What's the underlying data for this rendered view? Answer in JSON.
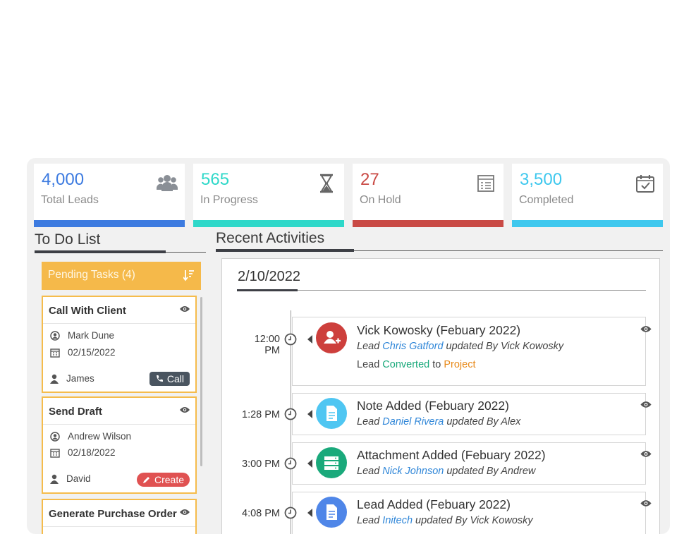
{
  "stats": [
    {
      "value": "4,000",
      "label": "Total Leads",
      "color": "#3d7be0",
      "icon": "users-icon"
    },
    {
      "value": "565",
      "label": "In Progress",
      "color": "#2ed8c9",
      "icon": "hourglass-icon"
    },
    {
      "value": "27",
      "label": "On Hold",
      "color": "#c94a45",
      "icon": "checklist-icon"
    },
    {
      "value": "3,500",
      "label": "Completed",
      "color": "#3fc8ee",
      "icon": "calendar-check-icon"
    }
  ],
  "todo": {
    "title": "To Do List",
    "pending_label": "Pending Tasks (4)",
    "tasks": [
      {
        "title": "Call With Client",
        "contact": "Mark Dune",
        "date": "02/15/2022",
        "assignee": "James",
        "action": "Call",
        "action_color": "#4a5560"
      },
      {
        "title": "Send Draft",
        "contact": "Andrew Wilson",
        "date": "02/18/2022",
        "assignee": "David",
        "action": "Create",
        "action_color": "#e05252"
      },
      {
        "title": "Generate Purchase Order"
      }
    ]
  },
  "recent": {
    "title": "Recent Activities",
    "date": "2/10/2022",
    "items": [
      {
        "time": "12:00 PM",
        "title": "Vick Kowosky  (Febuary 2022)",
        "icon": "add-user-icon",
        "color": "#cd3f3c",
        "line_prefix": "Lead ",
        "line_link": "Chris Gatford",
        "line_suffix": " updated By Vick Kowosky",
        "line2_prefix": "Lead ",
        "line2_green": "Converted",
        "line2_mid": " to ",
        "line2_orange": "Project"
      },
      {
        "time": "1:28 PM",
        "title": "Note Added  (Febuary 2022)",
        "icon": "document-icon",
        "color": "#4fc6f2",
        "line_prefix": "Lead ",
        "line_link": "Daniel Rivera",
        "line_suffix": " updated By Alex"
      },
      {
        "time": "3:00 PM",
        "title": "Attachment Added  (Febuary 2022)",
        "icon": "server-icon",
        "color": "#1aa97b",
        "line_prefix": "Lead ",
        "line_link": "Nick Johnson",
        "line_suffix": " updated By Andrew"
      },
      {
        "time": "4:08 PM",
        "title": "Lead Added  (Febuary 2022)",
        "icon": "document-icon",
        "color": "#4f86e8",
        "line_prefix": "Lead ",
        "line_link": "Initech",
        "line_suffix": " updated By Vick Kowosky"
      }
    ]
  }
}
